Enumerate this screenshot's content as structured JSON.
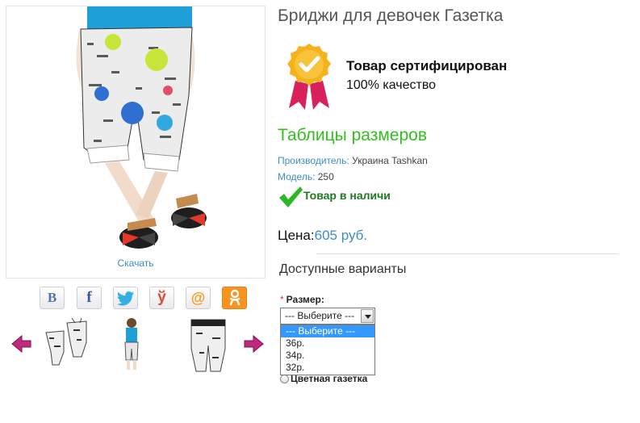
{
  "product": {
    "title": "Бриджи для девочек Газетка",
    "download_link": "Скачать",
    "certificate": {
      "title": "Товар сертифицирован",
      "subtitle": "100% качество"
    },
    "size_tables_link": "Таблицы размеров",
    "manufacturer": {
      "label": "Производитель:",
      "value": "Украина Tashkan"
    },
    "model": {
      "label": "Модель:",
      "value": "250"
    },
    "stock_status": "Товар в наличи",
    "price": {
      "label": "Цена:",
      "value": "605 руб."
    }
  },
  "social": [
    {
      "name": "vk-share-button",
      "glyph": "В",
      "icon": "vk-icon"
    },
    {
      "name": "facebook-share-button",
      "glyph": "f",
      "icon": "facebook-icon"
    },
    {
      "name": "twitter-share-button",
      "glyph": "",
      "icon": "twitter-bird-icon"
    },
    {
      "name": "moimir-share-button",
      "glyph": "ў",
      "icon": "moimir-icon"
    },
    {
      "name": "mailru-share-button",
      "glyph": "@",
      "icon": "mailru-at-icon"
    },
    {
      "name": "odnoklassniki-share-button",
      "glyph": "ок",
      "icon": "odnoklassniki-icon"
    }
  ],
  "gallery": {
    "prev_icon": "arrow-left-icon",
    "next_icon": "arrow-right-icon",
    "thumbnails": [
      "thumbnail-shorts-pair",
      "thumbnail-girl-in-outfit",
      "thumbnail-shorts-single"
    ]
  },
  "variants": {
    "title": "Доступные варианты",
    "size": {
      "required_mark": "*",
      "label": "Размер:",
      "selected": "--- Выберите ---",
      "options": [
        "--- Выберите ---",
        "36р.",
        "34р.",
        "32р."
      ]
    },
    "color_option": "Цветная газетка"
  },
  "colors": {
    "accent_blue": "#3a8dc8",
    "accent_green": "#32bf1e",
    "stock_green": "#1f7a1f",
    "selected_option": "#3399ff",
    "badge_gold": "#f5b21c",
    "badge_ribbon": "#d8205a",
    "gallery_arrow": "#c2287f"
  }
}
